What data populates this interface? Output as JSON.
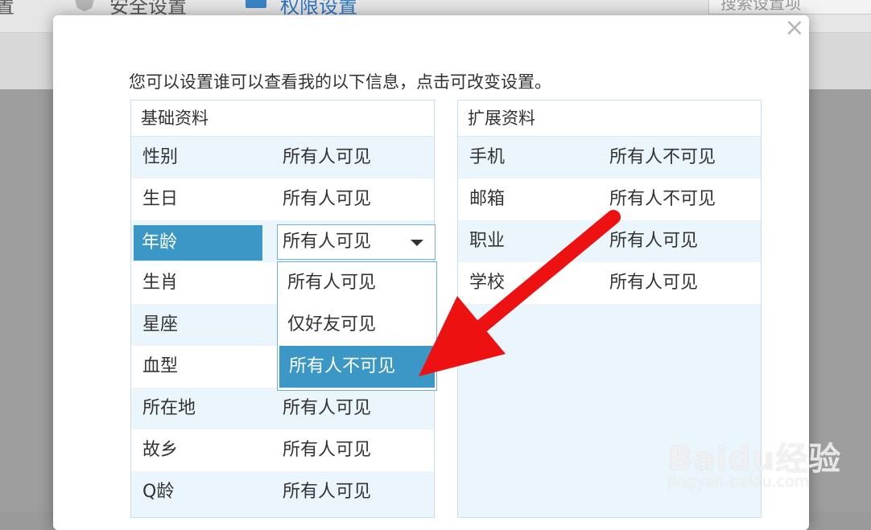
{
  "background": {
    "left_text": "置",
    "security_tab": "安全设置",
    "permission_tab": "权限设置",
    "search_placeholder": "搜索设置项"
  },
  "modal": {
    "close_glyph": "×",
    "intro": "您可以设置谁可以查看我的以下信息，点击可改变设置。"
  },
  "basic": {
    "title": "基础资料",
    "rows": [
      {
        "key": "性别",
        "value": "所有人可见"
      },
      {
        "key": "生日",
        "value": "所有人可见"
      },
      {
        "key": "年龄",
        "value": "所有人可见"
      },
      {
        "key": "生肖",
        "value": ""
      },
      {
        "key": "星座",
        "value": ""
      },
      {
        "key": "血型",
        "value": ""
      },
      {
        "key": "所在地",
        "value": "所有人可见"
      },
      {
        "key": "故乡",
        "value": "所有人可见"
      },
      {
        "key": "Q龄",
        "value": "所有人可见"
      }
    ]
  },
  "extended": {
    "title": "扩展资料",
    "rows": [
      {
        "key": "手机",
        "value": "所有人不可见"
      },
      {
        "key": "邮箱",
        "value": "所有人不可见"
      },
      {
        "key": "职业",
        "value": "所有人可见"
      },
      {
        "key": "学校",
        "value": "所有人可见"
      }
    ]
  },
  "dropdown": {
    "selected": "所有人可见",
    "options": [
      "所有人可见",
      "仅好友可见",
      "所有人不可见"
    ],
    "highlighted_index": 2
  },
  "watermark": {
    "logo": "Baidu经验",
    "url": "jingyan.baidu.com"
  },
  "colors": {
    "accent": "#3a97c6",
    "arrow": "#ee1111",
    "panel_tint": "#ebf5fc"
  }
}
